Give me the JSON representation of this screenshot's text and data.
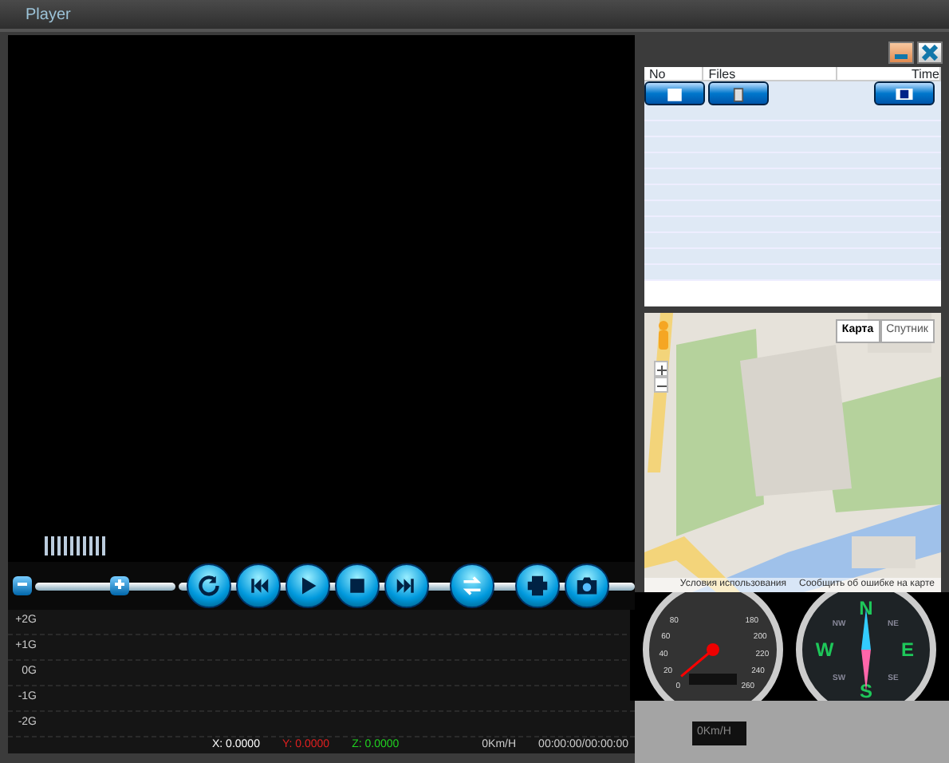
{
  "window": {
    "title": "Player"
  },
  "file_table": {
    "columns": [
      "No",
      "Files",
      "Time"
    ],
    "buttons": [
      {
        "kind": "folder"
      },
      {
        "kind": "delete"
      },
      {
        "kind": "film"
      }
    ]
  },
  "volume_slider": {
    "level": 0.6
  },
  "controls": [
    {
      "kind": "repeat"
    },
    {
      "kind": "previous"
    },
    {
      "kind": "play"
    },
    {
      "kind": "stop"
    },
    {
      "kind": "next"
    },
    {
      "kind": "swap"
    },
    {
      "kind": "print"
    },
    {
      "kind": "camera"
    }
  ],
  "accel_axis": [
    "+2G",
    "+1G",
    "0G",
    "-1G",
    "-2G"
  ],
  "readings": [
    {
      "label": "X: 0.0000",
      "color": "#ffffff"
    },
    {
      "label": "Y: 0.0000",
      "color": "#e02020"
    },
    {
      "label": "Z: 0.0000",
      "color": "#20d020"
    }
  ],
  "speed_text": "0Km/H",
  "time_text": "00:00:00/00:00:00",
  "map": {
    "types": [
      {
        "label": "Карта",
        "selected": true
      },
      {
        "label": "Спутник",
        "selected": false
      }
    ],
    "footer": [
      "Условия использования",
      "Сообщить об ошибке на карте"
    ]
  },
  "speedometer": {
    "labels": [
      "0",
      "20",
      "40",
      "60",
      "80",
      "180",
      "200",
      "220",
      "240",
      "260"
    ]
  },
  "compass": {
    "labels": [
      "N",
      "NE",
      "E",
      "SE",
      "S",
      "SW",
      "W",
      "NW"
    ]
  },
  "speed_display": "0Km/H"
}
